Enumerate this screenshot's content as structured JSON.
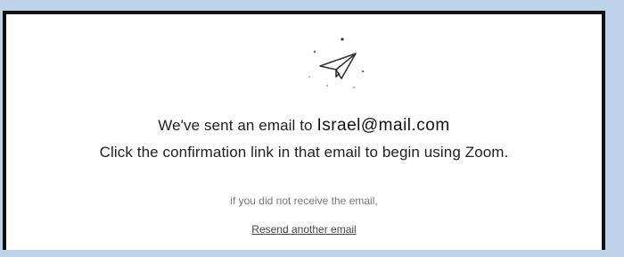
{
  "dialog": {
    "icon": "paper-plane-icon",
    "message_prefix": "We've sent an email to ",
    "email": "Israel@mail.com",
    "message_line2": "Click the confirmation link in that email to begin using Zoom.",
    "hint": "if you did not receive the email,",
    "resend_label": "Resend another email"
  },
  "colors": {
    "background": "#bcd3ea",
    "border": "#111111",
    "text": "#222222",
    "muted": "#777777"
  }
}
